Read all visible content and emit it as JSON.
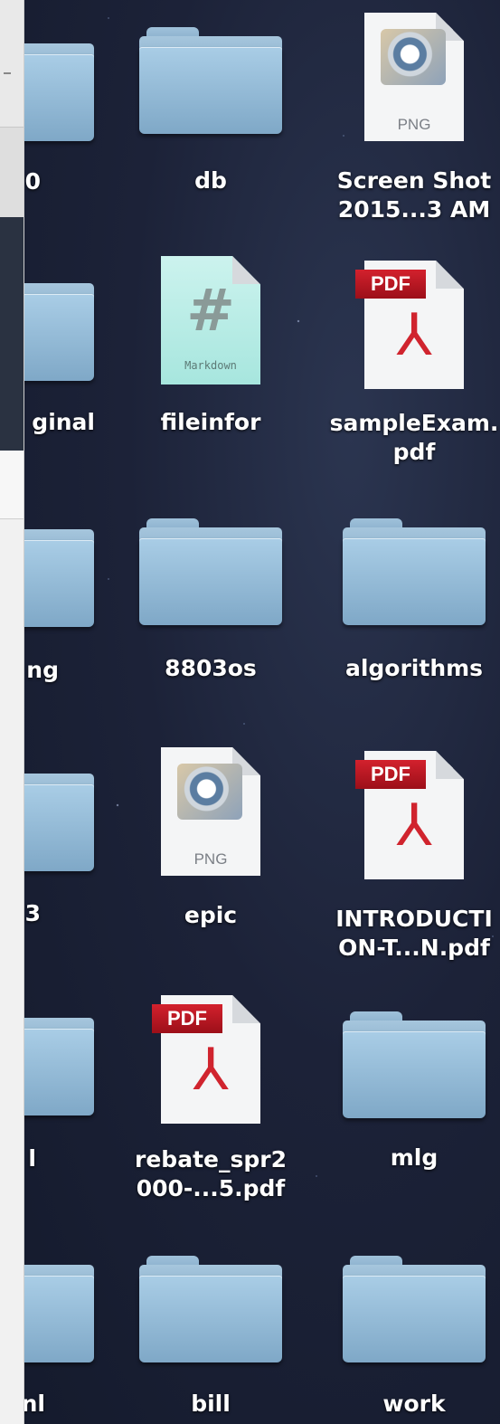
{
  "desktop": {
    "columns": [
      {
        "id": "col0",
        "items": [
          {
            "label": "0",
            "type": "folder"
          },
          {
            "label": "ginal",
            "type": "folder"
          },
          {
            "label": "ng",
            "type": "folder"
          },
          {
            "label": "3",
            "type": "folder"
          },
          {
            "label": "l",
            "type": "folder"
          },
          {
            "label": "nl",
            "type": "folder"
          }
        ]
      },
      {
        "id": "col1",
        "items": [
          {
            "label": "db",
            "type": "folder"
          },
          {
            "label": "fileinfor",
            "type": "markdown"
          },
          {
            "label": "8803os",
            "type": "folder"
          },
          {
            "label": "epic",
            "type": "png"
          },
          {
            "label": "rebate_spr2\n000-...5.pdf",
            "type": "pdf"
          },
          {
            "label": "bill",
            "type": "folder"
          }
        ]
      },
      {
        "id": "col2",
        "items": [
          {
            "label": "Screen Shot\n2015...3 AM",
            "type": "png"
          },
          {
            "label": "sampleExam.\npdf",
            "type": "pdf"
          },
          {
            "label": "algorithms",
            "type": "folder"
          },
          {
            "label": "INTRODUCTI\nON-T...N.pdf",
            "type": "pdf"
          },
          {
            "label": "mlg",
            "type": "folder"
          },
          {
            "label": "work",
            "type": "folder"
          }
        ]
      }
    ],
    "badges": {
      "pdf": "PDF",
      "png": "PNG",
      "markdown": "Markdown",
      "markdown_glyph": "#"
    }
  }
}
